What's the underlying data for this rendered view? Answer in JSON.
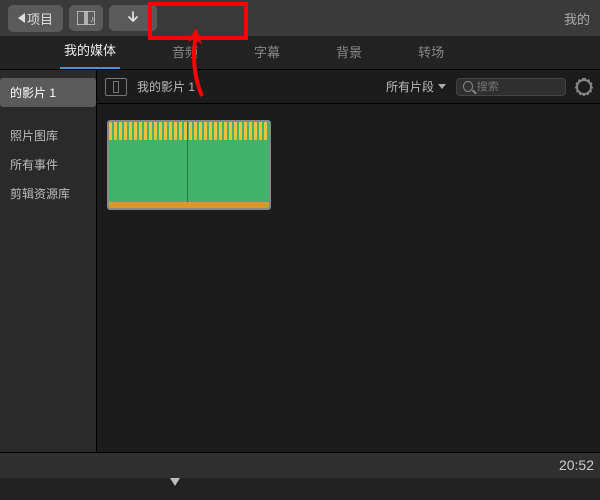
{
  "titlebar": {
    "back_label": "项目",
    "right_text": "我的"
  },
  "tabs": {
    "media": "我的媒体",
    "audio": "音频",
    "titles": "字幕",
    "backgrounds": "背景",
    "transitions": "转场"
  },
  "sidebar": {
    "recent_project": "的影片 1",
    "photos": "照片图库",
    "events": "所有事件",
    "resources": "剪辑资源库"
  },
  "browser": {
    "title": "我的影片 1",
    "filter_label": "所有片段",
    "search_placeholder": "搜索"
  },
  "footer": {
    "timecode": "20:52"
  }
}
